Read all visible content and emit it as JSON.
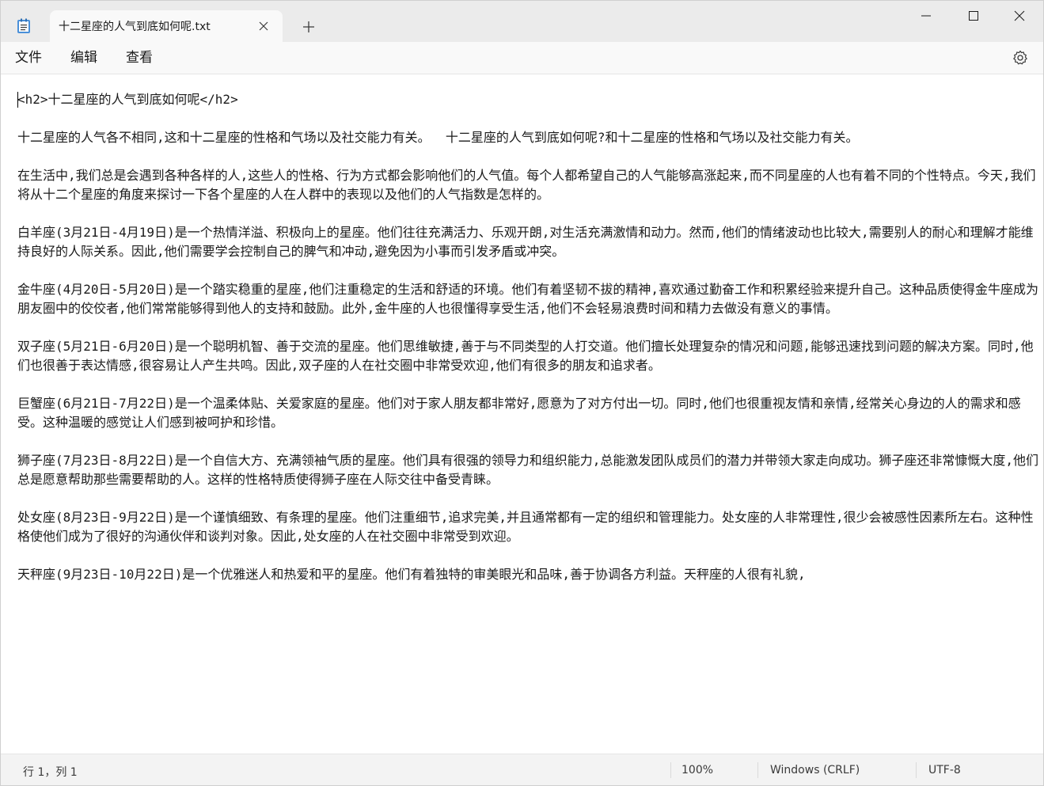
{
  "window": {
    "tab_title": "十二星座的人气到底如何呢.txt",
    "app_icon": "notepad-icon",
    "new_tab_icon": "plus-icon",
    "close_tab_icon": "close-icon",
    "controls": [
      "minimize-icon",
      "maximize-icon",
      "close-icon"
    ]
  },
  "menu": {
    "file": "文件",
    "edit": "编辑",
    "view": "查看",
    "settings_icon": "gear-icon"
  },
  "editor": {
    "lines": [
      "<h2>十二星座的人气到底如何呢</h2>",
      "",
      "十二星座的人气各不相同,这和十二星座的性格和气场以及社交能力有关。  十二星座的人气到底如何呢?和十二星座的性格和气场以及社交能力有关。",
      "",
      "在生活中,我们总是会遇到各种各样的人,这些人的性格、行为方式都会影响他们的人气值。每个人都希望自己的人气能够高涨起来,而不同星座的人也有着不同的个性特点。今天,我们将从十二个星座的角度来探讨一下各个星座的人在人群中的表现以及他们的人气指数是怎样的。",
      "",
      "白羊座(3月21日-4月19日)是一个热情洋溢、积极向上的星座。他们往往充满活力、乐观开朗,对生活充满激情和动力。然而,他们的情绪波动也比较大,需要别人的耐心和理解才能维持良好的人际关系。因此,他们需要学会控制自己的脾气和冲动,避免因为小事而引发矛盾或冲突。",
      "",
      "金牛座(4月20日-5月20日)是一个踏实稳重的星座,他们注重稳定的生活和舒适的环境。他们有着坚韧不拔的精神,喜欢通过勤奋工作和积累经验来提升自己。这种品质使得金牛座成为朋友圈中的佼佼者,他们常常能够得到他人的支持和鼓励。此外,金牛座的人也很懂得享受生活,他们不会轻易浪费时间和精力去做没有意义的事情。",
      "",
      "双子座(5月21日-6月20日)是一个聪明机智、善于交流的星座。他们思维敏捷,善于与不同类型的人打交道。他们擅长处理复杂的情况和问题,能够迅速找到问题的解决方案。同时,他们也很善于表达情感,很容易让人产生共鸣。因此,双子座的人在社交圈中非常受欢迎,他们有很多的朋友和追求者。",
      "",
      "巨蟹座(6月21日-7月22日)是一个温柔体贴、关爱家庭的星座。他们对于家人朋友都非常好,愿意为了对方付出一切。同时,他们也很重视友情和亲情,经常关心身边的人的需求和感受。这种温暖的感觉让人们感到被呵护和珍惜。",
      "",
      "狮子座(7月23日-8月22日)是一个自信大方、充满领袖气质的星座。他们具有很强的领导力和组织能力,总能激发团队成员们的潜力并带领大家走向成功。狮子座还非常慷慨大度,他们总是愿意帮助那些需要帮助的人。这样的性格特质使得狮子座在人际交往中备受青睐。",
      "",
      "处女座(8月23日-9月22日)是一个谨慎细致、有条理的星座。他们注重细节,追求完美,并且通常都有一定的组织和管理能力。处女座的人非常理性,很少会被感性因素所左右。这种性格使他们成为了很好的沟通伙伴和谈判对象。因此,处女座的人在社交圈中非常受到欢迎。",
      "",
      "天秤座(9月23日-10月22日)是一个优雅迷人和热爱和平的星座。他们有着独特的审美眼光和品味,善于协调各方利益。天秤座的人很有礼貌,"
    ]
  },
  "status": {
    "position": "行 1，列 1",
    "zoom": "100%",
    "line_ending": "Windows (CRLF)",
    "encoding": "UTF-8"
  }
}
